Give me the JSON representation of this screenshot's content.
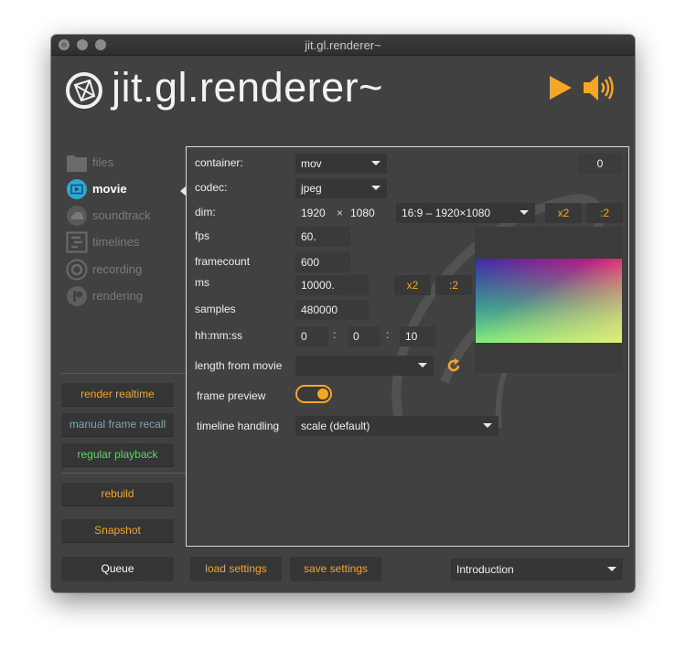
{
  "window": {
    "title": "jit.gl.renderer~"
  },
  "header": {
    "title": "jit.gl.renderer~",
    "logo_icon": "jitter-logo-icon",
    "play_icon": "play-icon",
    "speaker_icon": "speaker-icon"
  },
  "sidebar": {
    "items": [
      {
        "label": "files",
        "icon": "folder-icon"
      },
      {
        "label": "movie",
        "icon": "movie-icon"
      },
      {
        "label": "soundtrack",
        "icon": "cloud-icon"
      },
      {
        "label": "timelines",
        "icon": "timeline-icon"
      },
      {
        "label": "recording",
        "icon": "record-icon"
      },
      {
        "label": "rendering",
        "icon": "render-icon"
      }
    ],
    "buttons": {
      "render_realtime": "render realtime",
      "manual_frame_recall": "manual frame recall",
      "regular_playback": "regular playback",
      "rebuild": "rebuild",
      "snapshot": "Snapshot",
      "queue": "Queue"
    }
  },
  "form": {
    "container": {
      "label": "container:",
      "value": "mov",
      "count": "0"
    },
    "codec": {
      "label": "codec:",
      "value": "jpeg"
    },
    "dim": {
      "label": "dim:",
      "width": "1920",
      "x": "×",
      "height": "1080",
      "preset": "16:9 – 1920×1080",
      "x2": "x2",
      "half": ":2"
    },
    "fps": {
      "label": "fps",
      "value": "60."
    },
    "framecount": {
      "label": "framecount",
      "value": "600"
    },
    "ms": {
      "label": "ms",
      "value": "10000.",
      "x2": "x2",
      "half": ":2"
    },
    "samples": {
      "label": "samples",
      "value": "480000"
    },
    "hhmmss": {
      "label": "hh:mm:ss",
      "h": "0",
      "m": "0",
      "s": "10",
      "colon": ":"
    },
    "length_from_movie": {
      "label": "length from movie",
      "value": ""
    },
    "frame_preview": {
      "label": "frame preview",
      "enabled": true
    },
    "timeline_handling": {
      "label": "timeline handling",
      "value": "scale (default)"
    }
  },
  "footer": {
    "load_settings": "load settings",
    "save_settings": "save settings",
    "preset": "Introduction"
  },
  "colors": {
    "accent": "#f5a623",
    "manual_text": "#7fa6b0",
    "regular_text": "#5fd36a"
  }
}
